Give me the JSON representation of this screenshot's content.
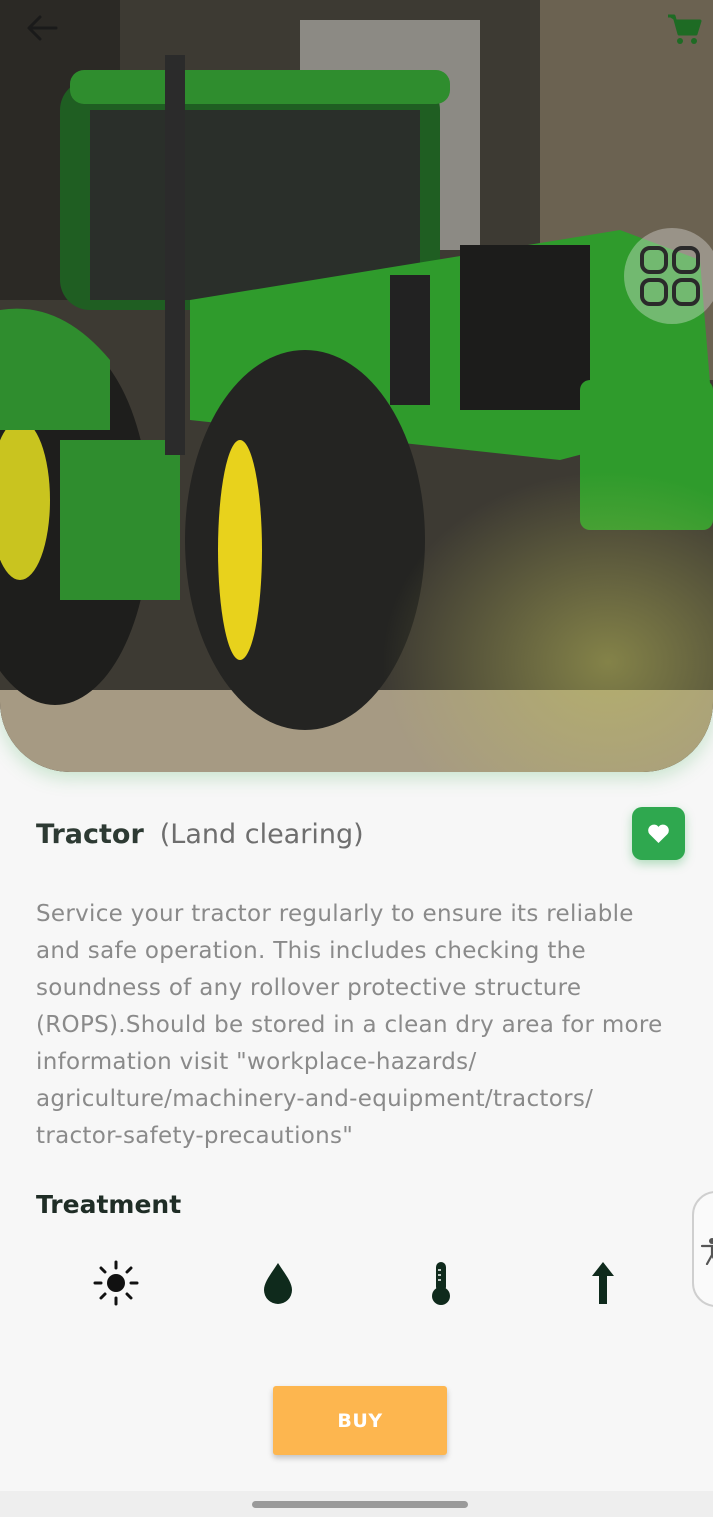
{
  "product": {
    "name": "Tractor",
    "category": "(Land clearing)",
    "description": "Service your tractor regularly to ensure its reliable and safe operation. This includes checking the soundness of any rollover protective structure (ROPS).Should be stored in a clean dry area for more information visit \"workplace-hazards/ agriculture/machinery-and-equipment/tractors/ tractor-safety-precautions\""
  },
  "treatment": {
    "title": "Treatment",
    "icons": [
      "sun-icon",
      "water-drop-icon",
      "thermometer-icon",
      "arrow-up-icon"
    ]
  },
  "actions": {
    "buy_label": "BUY"
  },
  "colors": {
    "favorite": "#2fa84f",
    "buy": "#fdb64f",
    "title": "#2d3a33",
    "description": "#8a8a8a"
  },
  "icons": {
    "back": "back-arrow-icon",
    "cart": "cart-icon",
    "ar": "ar-view-icon",
    "favorite": "heart-icon",
    "accessibility": "accessibility-icon"
  }
}
